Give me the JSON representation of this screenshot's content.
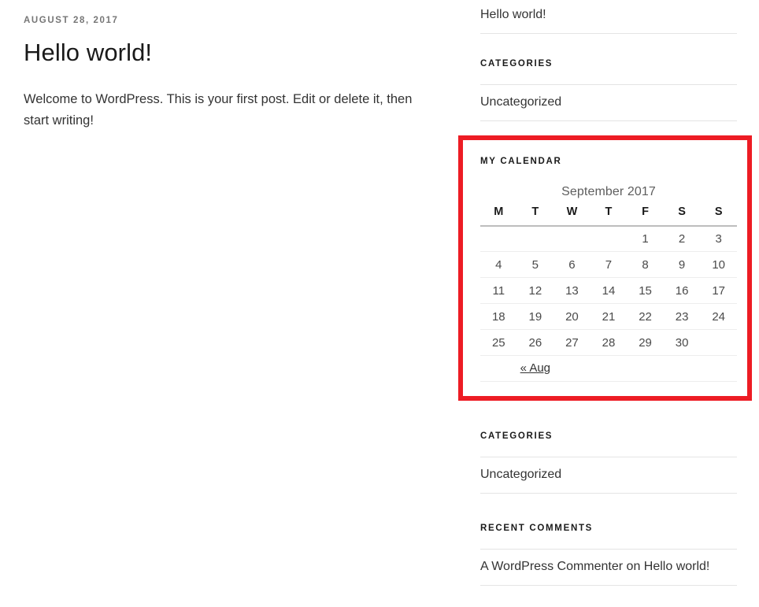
{
  "article": {
    "date": "AUGUST 28, 2017",
    "title": "Hello world!",
    "body": "Welcome to WordPress. This is your first post. Edit or delete it, then start writing!"
  },
  "sidebar": {
    "recent_posts_tail": {
      "items": [
        {
          "label": "Hello world!"
        }
      ]
    },
    "categories_top": {
      "title": "CATEGORIES",
      "items": [
        {
          "label": "Uncategorized"
        }
      ]
    },
    "calendar": {
      "title": "MY CALENDAR",
      "caption": "September 2017",
      "weekday_headers": [
        "M",
        "T",
        "W",
        "T",
        "F",
        "S",
        "S"
      ],
      "weeks": [
        [
          "",
          "",
          "",
          "",
          "1",
          "2",
          "3"
        ],
        [
          "4",
          "5",
          "6",
          "7",
          "8",
          "9",
          "10"
        ],
        [
          "11",
          "12",
          "13",
          "14",
          "15",
          "16",
          "17"
        ],
        [
          "18",
          "19",
          "20",
          "21",
          "22",
          "23",
          "24"
        ],
        [
          "25",
          "26",
          "27",
          "28",
          "29",
          "30",
          ""
        ]
      ],
      "prev_label": "« Aug",
      "next_label": "",
      "highlight_color": "#ed1c24"
    },
    "categories_bottom": {
      "title": "CATEGORIES",
      "items": [
        {
          "label": "Uncategorized"
        }
      ]
    },
    "recent_comments": {
      "title": "RECENT COMMENTS",
      "items": [
        {
          "author": "A WordPress Commenter",
          "connector": " on ",
          "post": "Hello world!"
        }
      ]
    }
  }
}
